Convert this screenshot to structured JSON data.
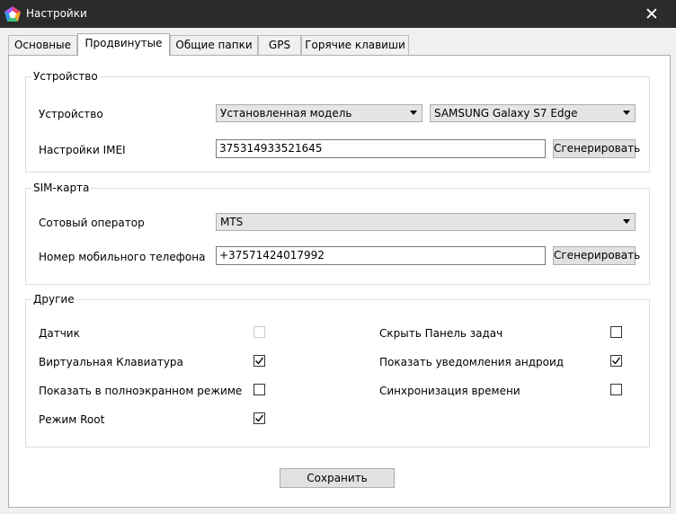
{
  "window": {
    "title": "Настройки",
    "close_glyph": "✕"
  },
  "tabs": [
    {
      "label": "Основные",
      "active": false
    },
    {
      "label": "Продвинутые",
      "active": true
    },
    {
      "label": "Общие папки",
      "active": false
    },
    {
      "label": "GPS",
      "active": false
    },
    {
      "label": "Горячие клавиши",
      "active": false
    }
  ],
  "device_group": {
    "legend": "Устройство",
    "device_label": "Устройство",
    "model_select": "Установленная модель",
    "device_select": "SAMSUNG Galaxy S7 Edge",
    "imei_label": "Настройки IMEI",
    "imei_value": "375314933521645",
    "imei_generate": "Сгенерировать"
  },
  "sim_group": {
    "legend": "SIM-карта",
    "operator_label": "Сотовый оператор",
    "operator_select": "MTS",
    "phone_label": "Номер мобильного телефона",
    "phone_value": "+37571424017992",
    "phone_generate": "Сгенерировать"
  },
  "other_group": {
    "legend": "Другие",
    "options": [
      {
        "label": "Датчик",
        "checked": false,
        "disabled": true
      },
      {
        "label": "Виртуальная Клавиатура",
        "checked": true,
        "disabled": false
      },
      {
        "label": "Показать в полноэкранном режиме",
        "checked": false,
        "disabled": false
      },
      {
        "label": "Режим Root",
        "checked": true,
        "disabled": false
      },
      {
        "label": "Скрыть Панель задач",
        "checked": false,
        "disabled": false
      },
      {
        "label": "Показать уведомления андроид",
        "checked": true,
        "disabled": false
      },
      {
        "label": "Синхронизация времени",
        "checked": false,
        "disabled": false
      }
    ]
  },
  "save_button": "Сохранить",
  "icons": {
    "app": "app-logo-icon",
    "check": "checkmark-icon",
    "dropdown": "chevron-down-icon",
    "close": "close-icon"
  },
  "colors": {
    "titlebar": "#2b2b2b",
    "window_bg": "#f0f0f0",
    "panel_bg": "#ffffff",
    "combo_bg": "#e5e5e5",
    "button_bg": "#e1e1e1"
  }
}
